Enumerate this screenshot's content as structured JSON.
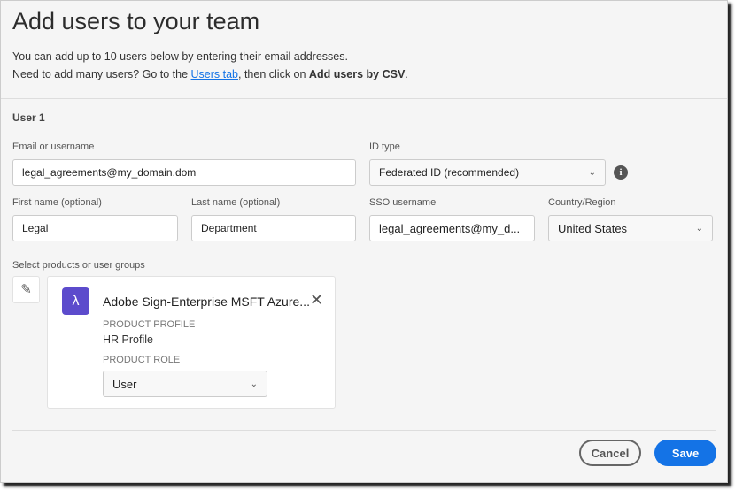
{
  "title": "Add users to your team",
  "intro": {
    "line1": "You can add up to 10 users below by entering their email addresses.",
    "line2_pre": "Need to add many users? Go to the ",
    "link": "Users tab",
    "line2_mid": ", then click on ",
    "line2_bold": "Add users by CSV",
    "line2_end": "."
  },
  "user_heading": "User 1",
  "fields": {
    "email": {
      "label": "Email or username",
      "value": "legal_agreements@my_domain.dom"
    },
    "id_type": {
      "label": "ID type",
      "value": "Federated ID (recommended)"
    },
    "first": {
      "label": "First name (optional)",
      "value": "Legal"
    },
    "last": {
      "label": "Last name (optional)",
      "value": "Department"
    },
    "sso": {
      "label": "SSO username",
      "value": "legal_agreements@my_d..."
    },
    "country": {
      "label": "Country/Region",
      "value": "United States"
    }
  },
  "products": {
    "label": "Select products or user groups",
    "name": "Adobe Sign-Enterprise MSFT Azure...",
    "profile_label": "PRODUCT PROFILE",
    "profile": "HR Profile",
    "role_label": "PRODUCT ROLE",
    "role": "User",
    "icon_color": "#5c4bcc"
  },
  "buttons": {
    "cancel": "Cancel",
    "save": "Save"
  },
  "colors": {
    "accent": "#1473e6"
  }
}
